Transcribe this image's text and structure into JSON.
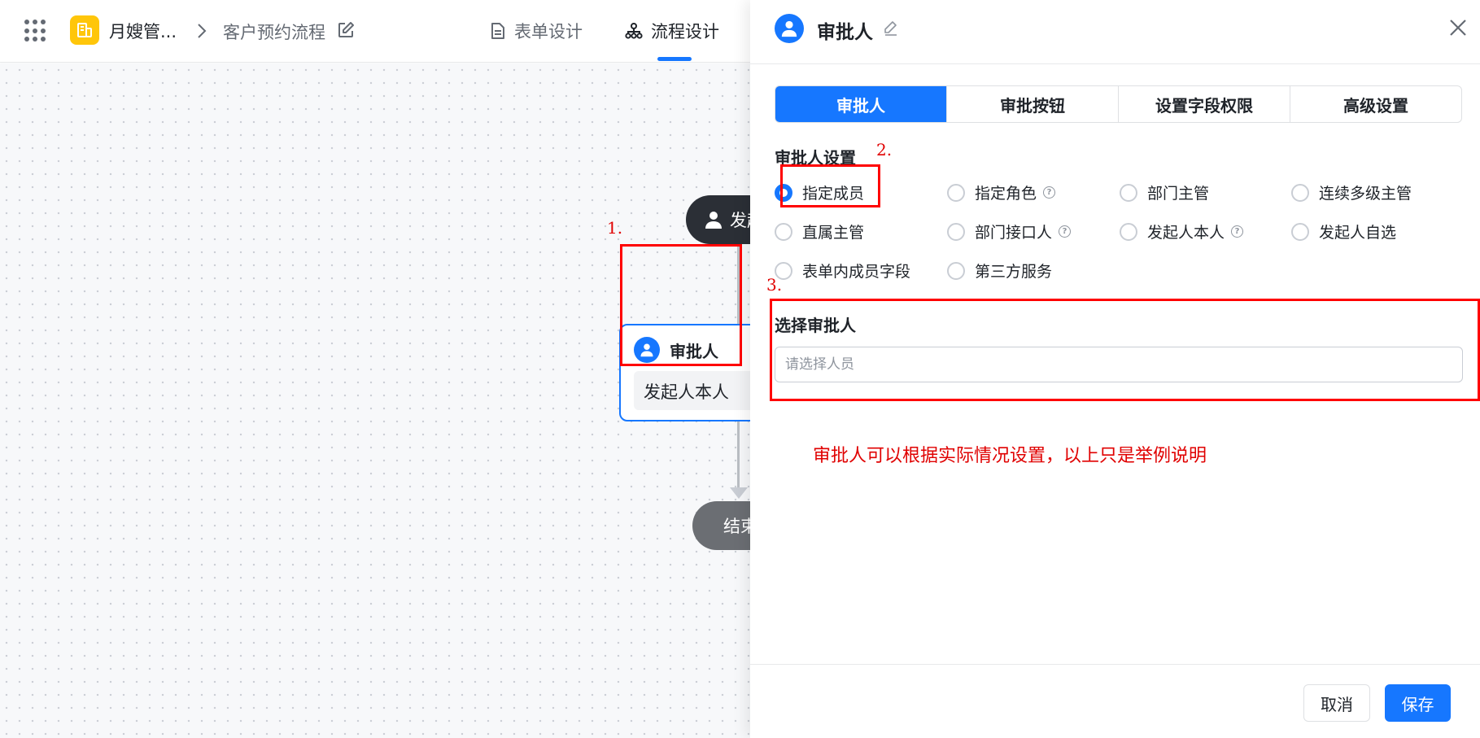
{
  "header": {
    "app_name": "月嫂管...",
    "breadcrumb_page": "客户预约流程",
    "tabs": [
      {
        "label": "表单设计",
        "icon": "document-icon",
        "active": false
      },
      {
        "label": "流程设计",
        "icon": "flow-chart-icon",
        "active": true
      }
    ]
  },
  "canvas": {
    "start_node": {
      "label": "发起人"
    },
    "approver_node": {
      "title": "审批人",
      "content": "发起人本人"
    },
    "end_node": {
      "label": "结束"
    },
    "annotation_1": "1."
  },
  "drawer": {
    "title": "审批人",
    "tabs": [
      {
        "label": "审批人",
        "active": true
      },
      {
        "label": "审批按钮",
        "active": false
      },
      {
        "label": "设置字段权限",
        "active": false
      },
      {
        "label": "高级设置",
        "active": false
      }
    ],
    "section_title": "审批人设置",
    "annotation_2": "2.",
    "annotation_3": "3.",
    "approver_types": [
      {
        "label": "指定成员",
        "checked": true,
        "help": false
      },
      {
        "label": "指定角色",
        "checked": false,
        "help": true
      },
      {
        "label": "部门主管",
        "checked": false,
        "help": false
      },
      {
        "label": "连续多级主管",
        "checked": false,
        "help": false
      },
      {
        "label": "直属主管",
        "checked": false,
        "help": false
      },
      {
        "label": "部门接口人",
        "checked": false,
        "help": true
      },
      {
        "label": "发起人本人",
        "checked": false,
        "help": true
      },
      {
        "label": "发起人自选",
        "checked": false,
        "help": false
      },
      {
        "label": "表单内成员字段",
        "checked": false,
        "help": false
      },
      {
        "label": "第三方服务",
        "checked": false,
        "help": false
      }
    ],
    "help_glyph": "?",
    "select_approver": {
      "label": "选择审批人",
      "placeholder": "请选择人员",
      "value": ""
    },
    "note": "审批人可以根据实际情况设置，以上只是举例说明",
    "buttons": {
      "cancel": "取消",
      "save": "保存"
    }
  },
  "colors": {
    "primary": "#1677ff",
    "annotation_red": "#ff0000",
    "app_logo": "#ffc60a",
    "start_node": "#2b2f36",
    "end_node": "#6b6e73"
  }
}
